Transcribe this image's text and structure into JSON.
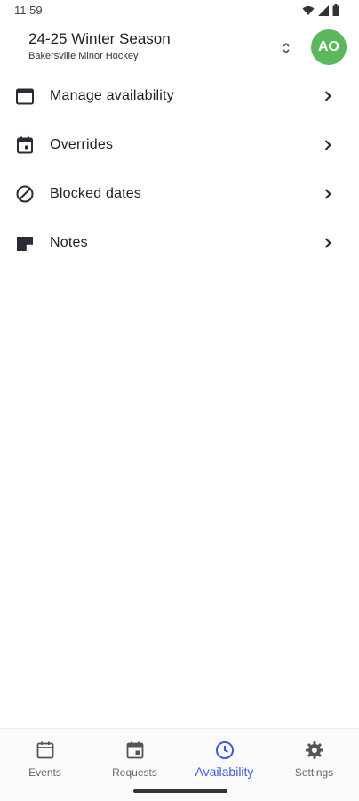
{
  "status_bar": {
    "time": "11:59"
  },
  "header": {
    "season_title": "24-25 Winter Season",
    "org_name": "Bakersville Minor Hockey",
    "avatar_initials": "AO",
    "avatar_color": "#5cb85c"
  },
  "menu": {
    "items": [
      {
        "label": "Manage availability",
        "icon": "calendar-icon"
      },
      {
        "label": "Overrides",
        "icon": "calendar-event-icon"
      },
      {
        "label": "Blocked dates",
        "icon": "block-icon"
      },
      {
        "label": "Notes",
        "icon": "note-icon"
      }
    ]
  },
  "bottom_nav": {
    "active": "Availability",
    "active_color": "#3b5bdb",
    "items": [
      {
        "label": "Events",
        "icon": "calendar-outline-icon"
      },
      {
        "label": "Requests",
        "icon": "calendar-event-icon"
      },
      {
        "label": "Availability",
        "icon": "clock-icon"
      },
      {
        "label": "Settings",
        "icon": "gear-icon"
      }
    ]
  }
}
